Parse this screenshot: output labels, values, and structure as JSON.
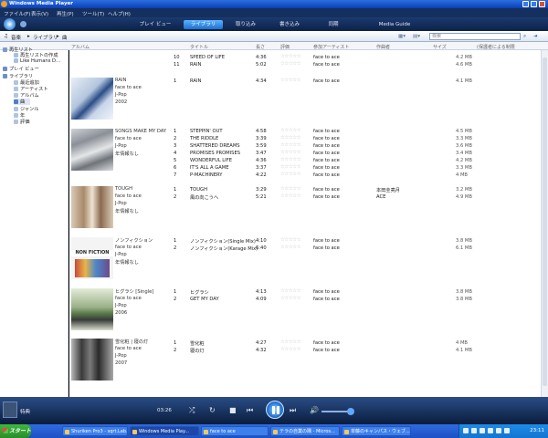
{
  "window": {
    "title": "Windows Media Player"
  },
  "menu": [
    "ファイル(F)",
    "表示(V)",
    "再生(P)",
    "ツール(T)",
    "ヘルプ(H)"
  ],
  "tabs": [
    {
      "label": "プレイ ビュー",
      "active": false
    },
    {
      "label": "ライブラリ",
      "active": true
    },
    {
      "label": "取り込み",
      "active": false
    },
    {
      "label": "書き込み",
      "active": false
    },
    {
      "label": "同期",
      "active": false
    },
    {
      "label": "Media Guide",
      "active": false
    }
  ],
  "breadcrumb": [
    "音楽",
    "ライブラリ",
    "曲"
  ],
  "search": {
    "placeholder": "検索"
  },
  "columns": {
    "album": "アルバム",
    "title": "タイトル",
    "length": "長さ",
    "rating": "評価",
    "artist": "参加アーティスト",
    "composer": "作曲者",
    "size": "サイズ",
    "protection": "(保護者による制限"
  },
  "nav": [
    {
      "label": "再生リスト",
      "level": 0,
      "icon": "playlist-icon"
    },
    {
      "label": "再生リストの作成",
      "level": 1,
      "icon": "new-playlist-icon"
    },
    {
      "label": "Like Humans D…",
      "level": 1,
      "icon": "playlist-icon"
    },
    {
      "label": "プレイ ビュー",
      "level": 0,
      "icon": "now-playing-icon"
    },
    {
      "label": "ライブラリ",
      "level": 0,
      "icon": "library-icon"
    },
    {
      "label": "最近追加",
      "level": 1,
      "icon": "recent-icon"
    },
    {
      "label": "アーティスト",
      "level": 1,
      "icon": "artist-icon"
    },
    {
      "label": "アルバム",
      "level": 1,
      "icon": "album-icon"
    },
    {
      "label": "曲",
      "level": 1,
      "icon": "song-icon",
      "selected": true
    },
    {
      "label": "ジャンル",
      "level": 1,
      "icon": "genre-icon"
    },
    {
      "label": "年",
      "level": 1,
      "icon": "year-icon"
    },
    {
      "label": "評価",
      "level": 1,
      "icon": "rating-icon"
    }
  ],
  "partial_rows": [
    {
      "no": "10",
      "title": "SPEED OF LIFE",
      "length": "4:36",
      "artist": "face to ace",
      "size": "4.2 MB"
    },
    {
      "no": "11",
      "title": "RAIN",
      "length": "5:02",
      "artist": "face to ace",
      "size": "4.6 MB"
    }
  ],
  "albums": [
    {
      "name": "RAIN",
      "artist": "face to ace",
      "genre": "J-Pop",
      "year": "2002",
      "tracks": [
        {
          "no": "1",
          "title": "RAIN",
          "length": "4:34",
          "artist": "face to ace",
          "composer": "",
          "size": "4.1 MB"
        }
      ]
    },
    {
      "name": "SONGS MAKE MY DAY",
      "artist": "face to ace",
      "genre": "J-Pop",
      "year": "年情報なし",
      "tracks": [
        {
          "no": "1",
          "title": "STEPPIN' OUT",
          "length": "4:58",
          "artist": "face to ace",
          "composer": "",
          "size": "4.5 MB"
        },
        {
          "no": "2",
          "title": "THE RIDDLE",
          "length": "3:39",
          "artist": "face to ace",
          "composer": "",
          "size": "3.3 MB"
        },
        {
          "no": "3",
          "title": "SHATTERED DREAMS",
          "length": "3:59",
          "artist": "face to ace",
          "composer": "",
          "size": "3.6 MB"
        },
        {
          "no": "4",
          "title": "PROMISES PROMISES",
          "length": "3:47",
          "artist": "face to ace",
          "composer": "",
          "size": "3.4 MB"
        },
        {
          "no": "5",
          "title": "WONDERFUL LIFE",
          "length": "4:36",
          "artist": "face to ace",
          "composer": "",
          "size": "4.2 MB"
        },
        {
          "no": "6",
          "title": "IT'S ALL A GAME",
          "length": "3:37",
          "artist": "face to ace",
          "composer": "",
          "size": "3.3 MB"
        },
        {
          "no": "7",
          "title": "P-MACHINERY",
          "length": "4:22",
          "artist": "face to ace",
          "composer": "",
          "size": "4 MB"
        }
      ]
    },
    {
      "name": "TOUGH",
      "artist": "face to ace",
      "genre": "J-Pop",
      "year": "年情報なし",
      "tracks": [
        {
          "no": "1",
          "title": "TOUGH",
          "length": "3:29",
          "artist": "face to ace",
          "composer": "本田圭亮月",
          "size": "3.2 MB"
        },
        {
          "no": "2",
          "title": "風の向こうへ",
          "length": "5:21",
          "artist": "face to ace",
          "composer": "ACE",
          "size": "4.9 MB"
        }
      ]
    },
    {
      "name": "ノンフィクション",
      "artist": "face to ace",
      "genre": "J-Pop",
      "year": "年情報なし",
      "tracks": [
        {
          "no": "1",
          "title": "ノンフィクション(Single Mix)",
          "length": "4:10",
          "artist": "face to ace",
          "composer": "",
          "size": "3.8 MB"
        },
        {
          "no": "2",
          "title": "ノンフィクション(Karage Mix)",
          "length": "6:40",
          "artist": "face to ace",
          "composer": "",
          "size": "6.1 MB"
        }
      ]
    },
    {
      "name": "ヒグラシ [Single]",
      "artist": "face to ace",
      "genre": "J-Pop",
      "year": "2006",
      "tracks": [
        {
          "no": "1",
          "title": "ヒグラシ",
          "length": "4:13",
          "artist": "face to ace",
          "composer": "",
          "size": "3.8 MB"
        },
        {
          "no": "2",
          "title": "GET MY DAY",
          "length": "4:09",
          "artist": "face to ace",
          "composer": "",
          "size": "3.8 MB"
        }
      ]
    },
    {
      "name": "雪化粧 | 寝の灯",
      "artist": "face to ace",
      "genre": "J-Pop",
      "year": "2007",
      "tracks": [
        {
          "no": "1",
          "title": "雪化粧",
          "length": "4:27",
          "artist": "face to ace",
          "composer": "",
          "size": "4 MB"
        },
        {
          "no": "2",
          "title": "寝の灯",
          "length": "4:32",
          "artist": "face to ace",
          "composer": "",
          "size": "4.1 MB"
        }
      ]
    }
  ],
  "player": {
    "status": "特典",
    "time": "03:26"
  },
  "taskbar": {
    "start": "スタート",
    "buttons": [
      {
        "label": "Shuriken Pro3 - sqrt.Lab..."
      },
      {
        "label": "Windows Media Play...",
        "active": true
      },
      {
        "label": "face to ace"
      },
      {
        "label": "テラの自業の隅 - Micros..."
      },
      {
        "label": "单藤のキャンパス・ウェブ..."
      }
    ],
    "clock": "23:11"
  }
}
